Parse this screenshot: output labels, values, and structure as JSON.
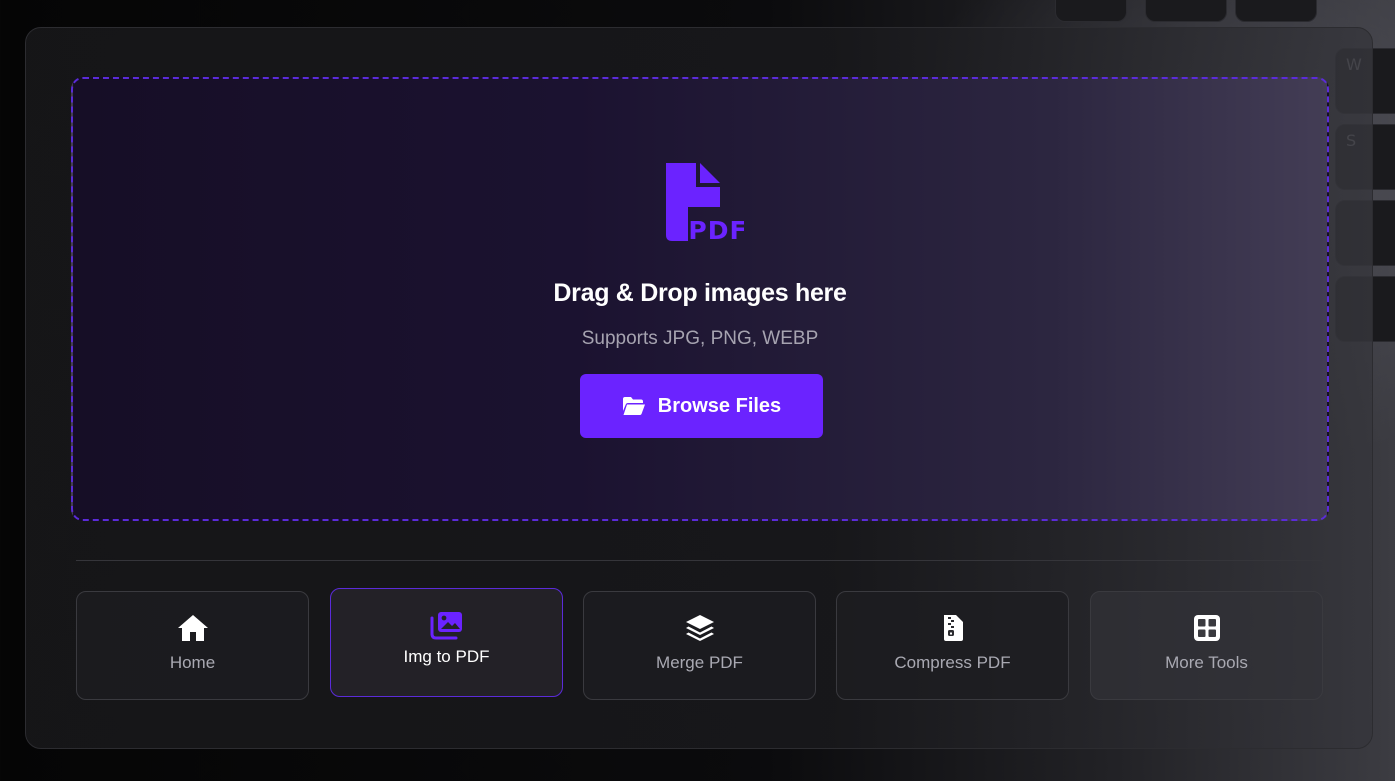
{
  "dropzone": {
    "title": "Drag & Drop images here",
    "subtitle": "Supports JPG, PNG, WEBP",
    "icon": "pdf-file-icon",
    "icon_text": "PDF",
    "browse_label": "Browse Files",
    "browse_icon": "folder-open-icon"
  },
  "nav": {
    "items": [
      {
        "label": "Home",
        "icon": "home-icon",
        "active": false
      },
      {
        "label": "Img to PDF",
        "icon": "images-icon",
        "active": true
      },
      {
        "label": "Merge PDF",
        "icon": "layers-icon",
        "active": false
      },
      {
        "label": "Compress PDF",
        "icon": "file-zipper-icon",
        "active": false
      },
      {
        "label": "More Tools",
        "icon": "grid-icon",
        "active": false
      }
    ]
  },
  "background": {
    "keys": [
      "W",
      "S"
    ]
  },
  "colors": {
    "accent": "#6b23ff",
    "dropzone_border": "#5b2bd9",
    "card_border": "#2c2c30",
    "text_muted": "#a9a9b2"
  }
}
